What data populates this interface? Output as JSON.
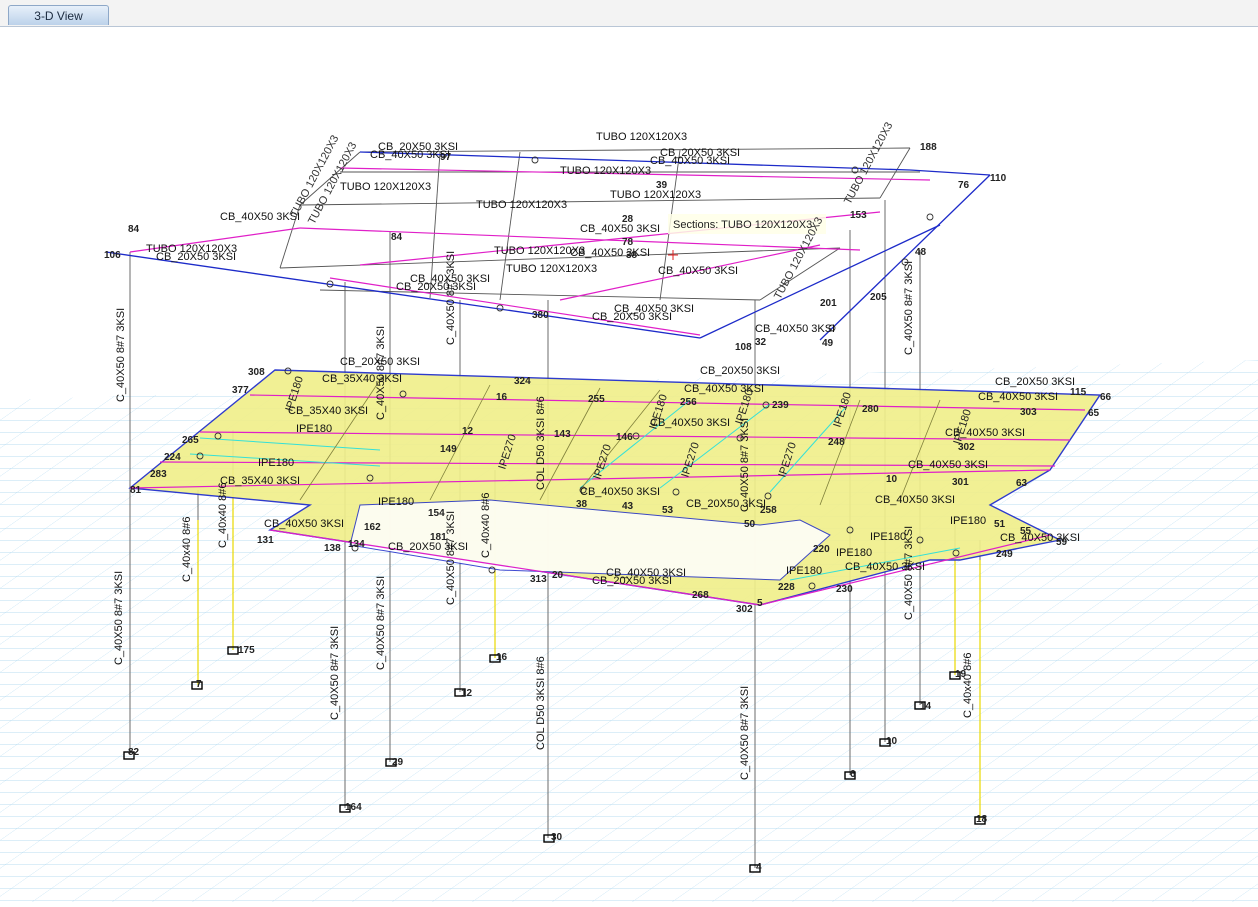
{
  "tab": {
    "label": "3-D View"
  },
  "tooltip": {
    "text": "Sections: TUBO 120X120X3"
  },
  "labels": {
    "roof_top": "TUBO 120X120X3",
    "tubo": "TUBO 120X120X3",
    "cb4050": "CB_40X50 3KSI",
    "cb2050": "CB_20X50 3KSI",
    "cb3540": "CB_35X40 3KSI",
    "ipe180": "IPE180",
    "ipe270": "IPE270",
    "col_main": "C_40X50 8#7 3KSI",
    "col_small": "C_40x40 8#6",
    "col_round": "COL D50 3KSI 8#6"
  },
  "nodes": [
    "106",
    "84",
    "153",
    "38",
    "39",
    "28",
    "78",
    "188",
    "97",
    "76",
    "110",
    "205",
    "201",
    "48",
    "49",
    "32",
    "108",
    "380",
    "12",
    "149",
    "115",
    "65",
    "66",
    "10",
    "63",
    "51",
    "55",
    "59",
    "249",
    "5",
    "302",
    "268",
    "313",
    "20",
    "38",
    "43",
    "53",
    "258",
    "50",
    "131",
    "138",
    "134",
    "84",
    "81",
    "162",
    "154",
    "181",
    "265",
    "224",
    "283",
    "377",
    "308",
    "324",
    "16",
    "143",
    "146",
    "255",
    "256",
    "239",
    "280",
    "248",
    "301",
    "303",
    "302",
    "230",
    "228",
    "220",
    "7",
    "175",
    "82",
    "29",
    "164",
    "30",
    "12",
    "16",
    "4",
    "6",
    "10",
    "14",
    "19",
    "18"
  ],
  "supports": [
    "7",
    "175",
    "82",
    "29",
    "164",
    "30",
    "12",
    "16",
    "4",
    "6",
    "10",
    "14",
    "18",
    "19"
  ]
}
